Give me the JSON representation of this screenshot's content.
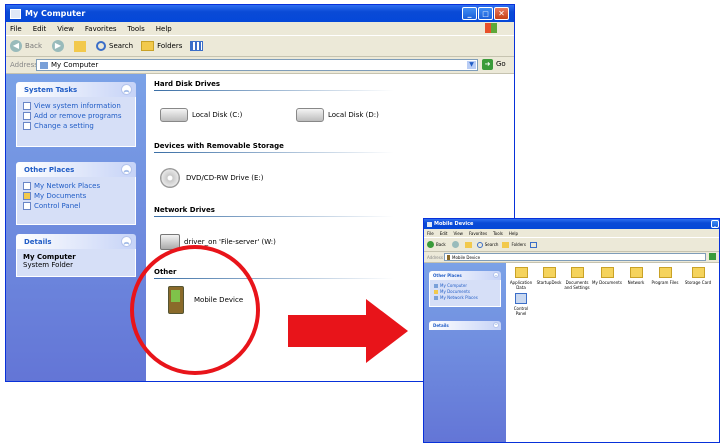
{
  "main_window": {
    "title": "My Computer",
    "menu": [
      "File",
      "Edit",
      "View",
      "Favorites",
      "Tools",
      "Help"
    ],
    "toolbar": {
      "back": "Back",
      "search": "Search",
      "folders": "Folders"
    },
    "address_label": "Address",
    "address_value": "My Computer",
    "go": "Go",
    "panels": {
      "system_tasks": {
        "title": "System Tasks",
        "links": [
          "View system information",
          "Add or remove programs",
          "Change a setting"
        ]
      },
      "other_places": {
        "title": "Other Places",
        "links": [
          "My Network Places",
          "My Documents",
          "Control Panel"
        ]
      },
      "details": {
        "title": "Details",
        "name": "My Computer",
        "type": "System Folder"
      }
    },
    "sections": {
      "hard_disk": {
        "title": "Hard Disk Drives",
        "items": [
          "Local Disk (C:)",
          "Local Disk (D:)"
        ]
      },
      "removable": {
        "title": "Devices with Removable Storage",
        "items": [
          "DVD/CD-RW Drive (E:)"
        ]
      },
      "network": {
        "title": "Network Drives",
        "items": [
          "driver_on 'File-server' (W:)"
        ]
      },
      "other": {
        "title": "Other",
        "items": [
          "Mobile Device"
        ]
      }
    }
  },
  "mobile_window": {
    "title": "Mobile Device",
    "menu": [
      "File",
      "Edit",
      "View",
      "Favorites",
      "Tools",
      "Help"
    ],
    "toolbar": {
      "back": "Back",
      "search": "Search",
      "folders": "Folders"
    },
    "address_label": "Address",
    "address_value": "Mobile Device",
    "panels": {
      "other_places": {
        "title": "Other Places",
        "links": [
          "My Computer",
          "My Documents",
          "My Network Places"
        ]
      },
      "details": {
        "title": "Details"
      }
    },
    "folders": [
      "Application Data",
      "StartupDesk",
      "Documents and Settings",
      "My Documents",
      "Network",
      "Program Files",
      "Storage Card"
    ],
    "extra_item": "Control Panel"
  },
  "colors": {
    "highlight_circle": "#e8141a",
    "arrow": "#e8141a",
    "xp_blue": "#0a4ad6"
  }
}
